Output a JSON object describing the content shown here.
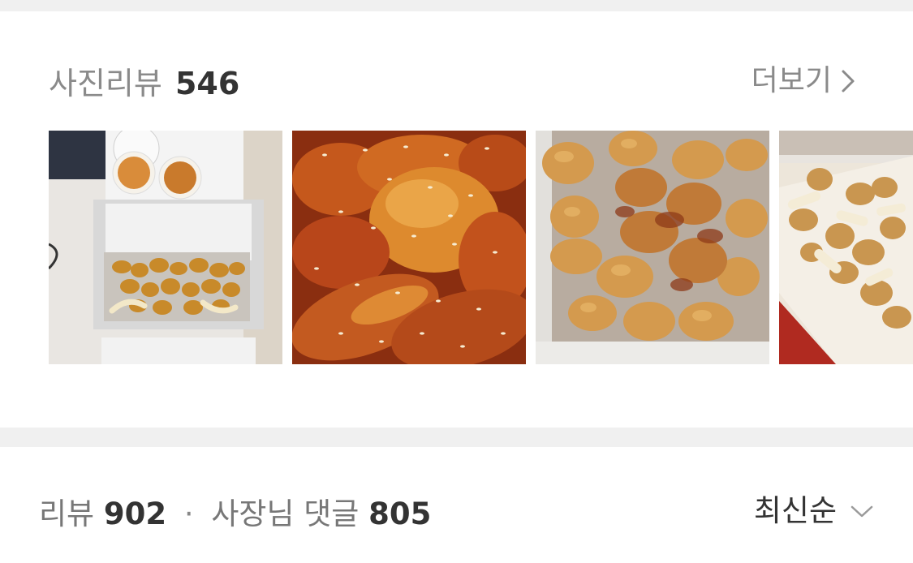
{
  "photo_reviews": {
    "label": "사진리뷰",
    "count": "546",
    "more_label": "더보기",
    "photos": [
      {
        "icon": "chicken-box-photo"
      },
      {
        "icon": "glazed-chicken-photo"
      },
      {
        "icon": "boneless-chicken-photo"
      },
      {
        "icon": "chicken-with-rice-cakes-photo"
      }
    ]
  },
  "reviews": {
    "label": "리뷰",
    "count": "902",
    "separator": "·",
    "owner_reply_label": "사장님 댓글",
    "owner_reply_count": "805",
    "sort_label": "최신순"
  },
  "colors": {
    "divider": "#f0f0f0",
    "muted_text": "#8a8a8a",
    "strong_text": "#333333"
  }
}
